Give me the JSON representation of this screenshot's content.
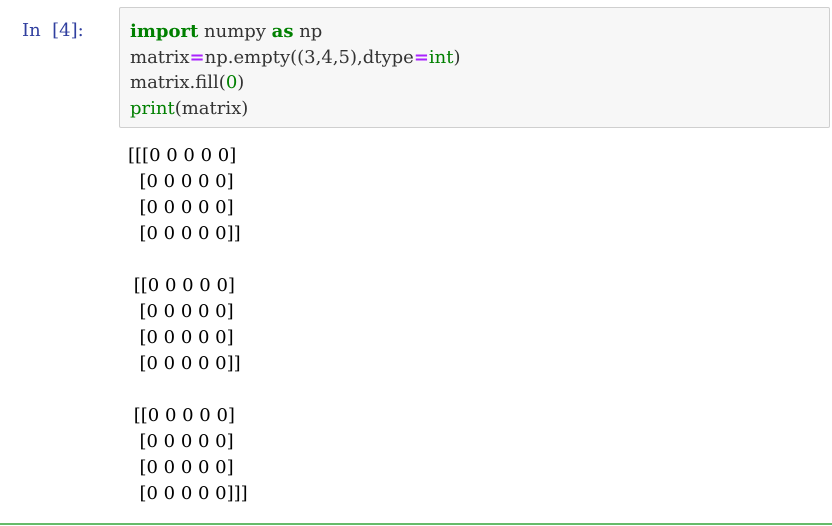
{
  "cell": {
    "prompt": "In  [4]:",
    "code": {
      "line1": {
        "kw_import": "import",
        "mod": " numpy ",
        "kw_as": "as",
        "alias": " np"
      },
      "line2": {
        "var": "matrix",
        "eq": "=",
        "call": "np.empty((3,4,5),dtype",
        "eq2": "=",
        "dtype": "int",
        "close": ")"
      },
      "line3": {
        "call": "matrix.fill(",
        "arg": "0",
        "close": ")"
      },
      "line4": {
        "fn": "print",
        "args": "(matrix)"
      }
    },
    "output_lines": [
      "[[[0 0 0 0 0]",
      "  [0 0 0 0 0]",
      "  [0 0 0 0 0]",
      "  [0 0 0 0 0]]",
      "",
      " [[0 0 0 0 0]",
      "  [0 0 0 0 0]",
      "  [0 0 0 0 0]",
      "  [0 0 0 0 0]]",
      "",
      " [[0 0 0 0 0]",
      "  [0 0 0 0 0]",
      "  [0 0 0 0 0]",
      "  [0 0 0 0 0]]]"
    ]
  },
  "colors": {
    "prompt": "#303f9f",
    "keyword": "#008000",
    "operator": "#aa22ff",
    "input_background": "#f7f7f7",
    "input_border": "#cfcfcf",
    "selected_cell_rule": "#66bb6a"
  }
}
